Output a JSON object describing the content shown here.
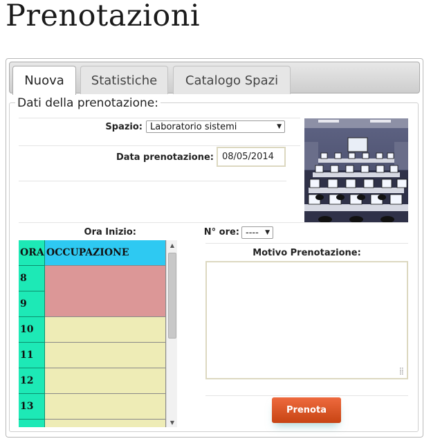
{
  "page": {
    "title": "Prenotazioni"
  },
  "tabs": [
    {
      "label": "Nuova",
      "active": true
    },
    {
      "label": "Statistiche",
      "active": false
    },
    {
      "label": "Catalogo Spazi",
      "active": false
    }
  ],
  "form": {
    "legend": "Dati della prenotazione:",
    "spazio": {
      "label": "Spazio:",
      "value": "Laboratorio sistemi"
    },
    "data": {
      "label": "Data prenotazione:",
      "value": "08/05/2014"
    },
    "ora_inizio": {
      "label": "Ora Inizio:"
    },
    "num_ore": {
      "label": "N° ore:",
      "value": "----"
    },
    "motivo": {
      "label": "Motivo Prenotazione:",
      "value": ""
    },
    "submit_label": "Prenota"
  },
  "grid": {
    "headers": {
      "ora": "ORA",
      "occupazione": "OCCUPAZIONE"
    },
    "rows": [
      {
        "ora": "8",
        "occupied": true
      },
      {
        "ora": "9",
        "occupied": true
      },
      {
        "ora": "10",
        "occupied": false
      },
      {
        "ora": "11",
        "occupied": false
      },
      {
        "ora": "12",
        "occupied": false
      },
      {
        "ora": "13",
        "occupied": false
      }
    ],
    "colors": {
      "ora_col": "#1de9b6",
      "header_occ": "#2ec9f2",
      "occupied": "#dc9797",
      "free": "#eeecb6"
    }
  },
  "icons": {
    "dropdown": "caret-down-icon",
    "scroll_up": "arrow-up-icon",
    "scroll_down": "arrow-down-icon",
    "resize": "resize-grip-icon"
  },
  "colors": {
    "button": "#dc5522",
    "field_border": "#dcd8c0"
  }
}
